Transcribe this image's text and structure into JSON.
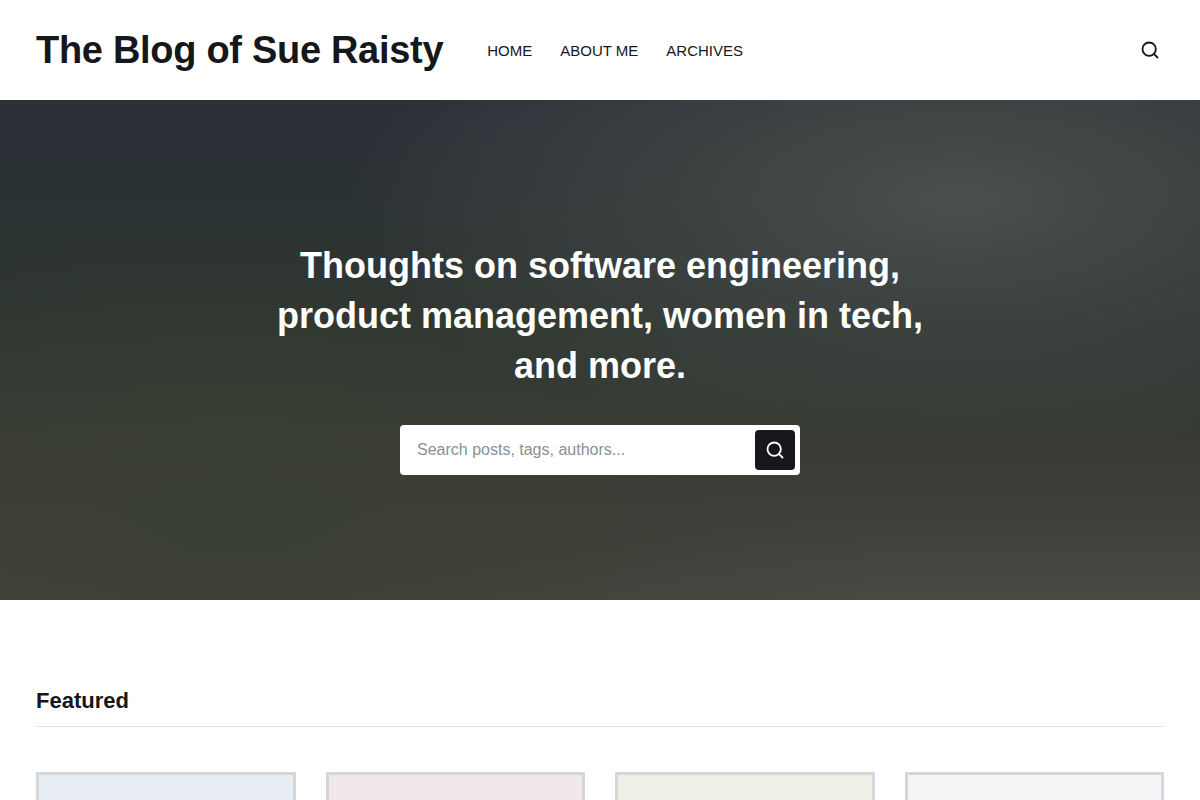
{
  "header": {
    "title": "The Blog of Sue Raisty",
    "nav": [
      {
        "label": "HOME"
      },
      {
        "label": "ABOUT ME"
      },
      {
        "label": "ARCHIVES"
      }
    ]
  },
  "hero": {
    "heading": "Thoughts on software engineering, product management, women in tech, and more.",
    "search": {
      "placeholder": "Search posts, tags, authors..."
    }
  },
  "featured": {
    "title": "Featured",
    "cards": [
      {
        "color": "#e8eef3"
      },
      {
        "color": "#f1e9e9"
      },
      {
        "color": "#eef0e6"
      },
      {
        "color": "#f4f5f7"
      }
    ]
  }
}
